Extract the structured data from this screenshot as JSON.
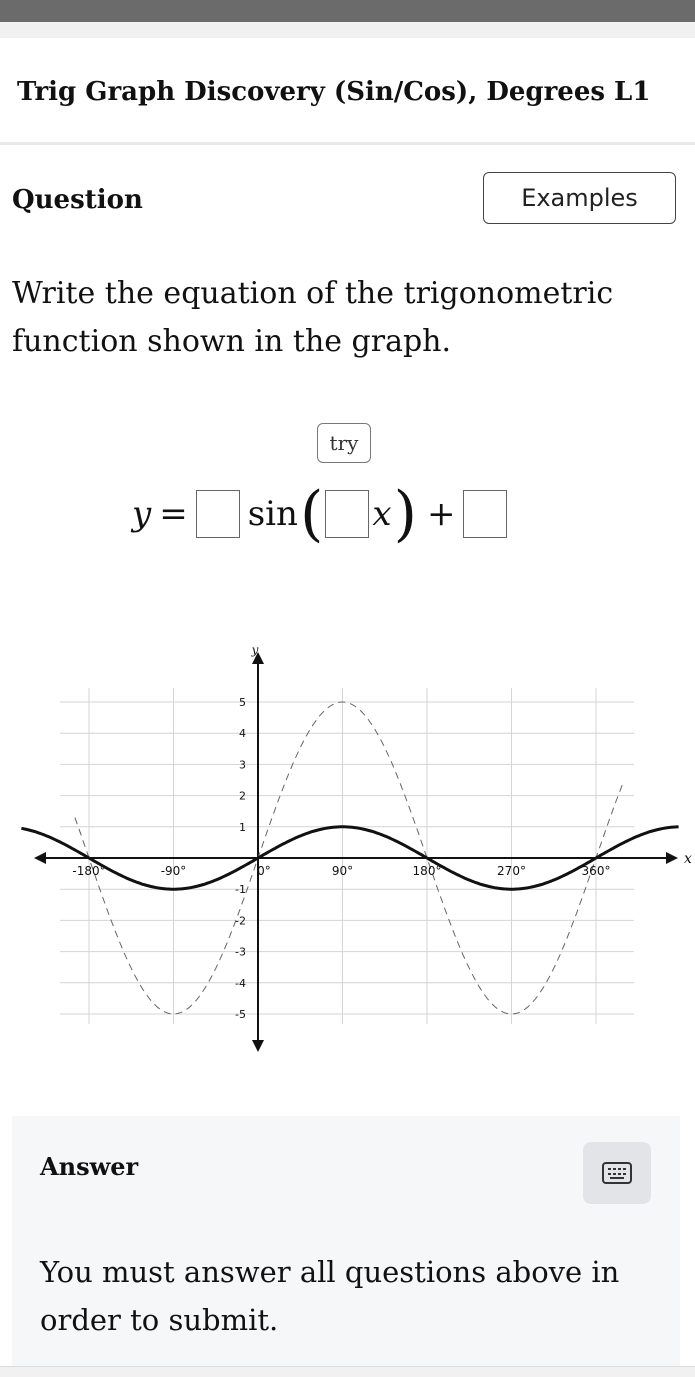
{
  "header": {
    "title": "Trig Graph Discovery (Sin/Cos), Degrees L1"
  },
  "question": {
    "heading": "Question",
    "examples_label": "Examples",
    "prompt": "Write the equation of the trigonometric function shown in the graph.",
    "try_label": "try",
    "equation": {
      "lhs": "y",
      "equals": "=",
      "func": "sin",
      "var": "x",
      "plus": "+",
      "open_paren": "(",
      "close_paren": ")"
    }
  },
  "graph": {
    "x_axis_label": "x",
    "y_axis_label": "y",
    "x_tick_labels": [
      "-180°",
      "-90°",
      "0°",
      "90°",
      "180°",
      "270°",
      "360°"
    ],
    "y_tick_labels": [
      "5",
      "4",
      "3",
      "2",
      "1",
      "-1",
      "-2",
      "-3",
      "-4",
      "-5"
    ]
  },
  "answer": {
    "heading": "Answer",
    "keyboard_icon": "keyboard-icon",
    "message": "You must answer all questions above in order to submit."
  },
  "chart_data": {
    "type": "line",
    "xlabel": "x",
    "ylabel": "y",
    "xlim": [
      -195,
      390
    ],
    "ylim": [
      -5,
      5
    ],
    "x_ticks": [
      -180,
      -90,
      0,
      90,
      180,
      270,
      360
    ],
    "y_ticks": [
      -5,
      -4,
      -3,
      -2,
      -1,
      1,
      2,
      3,
      4,
      5
    ],
    "grid": true,
    "series": [
      {
        "style": "dashed",
        "function": "y = 5 sin(x)",
        "points": [
          [
            -180,
            0
          ],
          [
            -90,
            -5
          ],
          [
            0,
            0
          ],
          [
            90,
            5
          ],
          [
            180,
            0
          ],
          [
            270,
            -5
          ],
          [
            360,
            0
          ]
        ]
      },
      {
        "style": "solid",
        "function": "y = sin(x)",
        "points": [
          [
            -180,
            0
          ],
          [
            -90,
            -1
          ],
          [
            0,
            0
          ],
          [
            90,
            1
          ],
          [
            180,
            0
          ],
          [
            270,
            -1
          ],
          [
            360,
            0
          ]
        ]
      }
    ]
  }
}
